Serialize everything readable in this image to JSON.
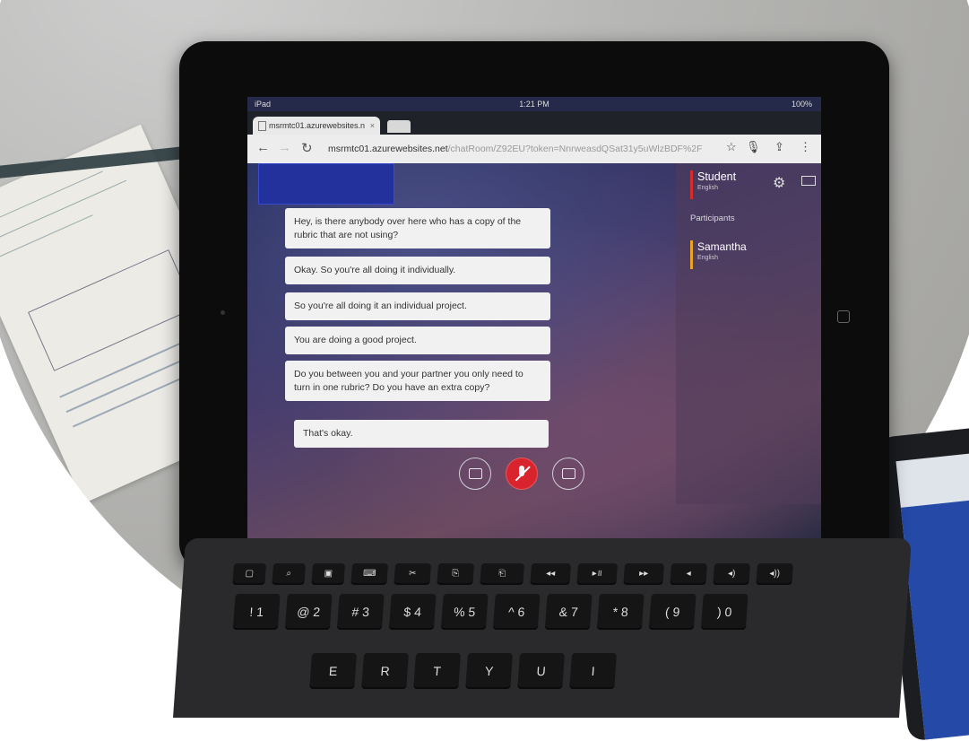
{
  "status_bar": {
    "device": "iPad",
    "time": "1:21 PM",
    "battery": "100%"
  },
  "browser": {
    "tab_title": "msrmtc01.azurewebsites.n",
    "url_host": "msrmtc01.azurewebsites.net",
    "url_path": "/chatRoom/Z92EU?token=NnrweasdQSat31y5uWlzBDF%2F"
  },
  "chat": {
    "messages": [
      "Hey, is there anybody over here who has a copy of the rubric that are not using?",
      "Okay. So you're all doing it individually.",
      "So you're all doing it an individual project.",
      "You are doing a good project.",
      "Do you between you and your partner you only need to turn in one rubric? Do you have an extra copy?",
      "That's okay."
    ]
  },
  "sidebar": {
    "user_name": "Student",
    "user_language": "English",
    "participants_label": "Participants",
    "participant_name": "Samantha",
    "participant_language": "English",
    "user_color": "#d52c2c",
    "participant_color": "#e9a421"
  },
  "keyboard": {
    "number_row": [
      "! 1",
      "@ 2",
      "# 3",
      "$ 4",
      "% 5",
      "^ 6",
      "& 7",
      "* 8",
      "( 9",
      ") 0"
    ],
    "letter_row": [
      "E",
      "R",
      "T",
      "Y",
      "U",
      "I"
    ]
  }
}
